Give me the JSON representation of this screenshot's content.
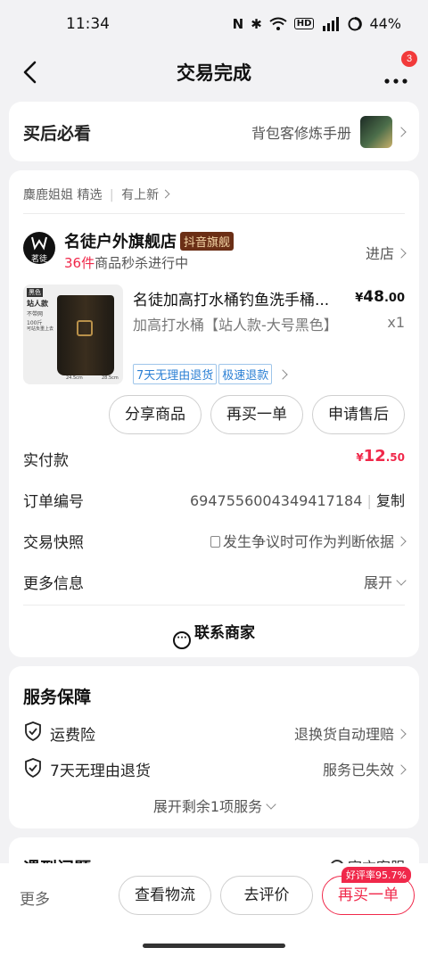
{
  "status_bar": {
    "time": "11:34",
    "battery": "44%"
  },
  "header": {
    "title": "交易完成",
    "badge_count": "3"
  },
  "aftersale": {
    "label": "买后必看",
    "guide": "背包客修炼手册"
  },
  "order": {
    "source": "麋鹿姐姐 精选",
    "source_link": "有上新",
    "store": {
      "name": "名徒户外旗舰店",
      "tag": "抖音旗舰",
      "flash_count": "36件",
      "flash_text": "商品秒杀进行中",
      "enter_label": "进店",
      "logo_text": "茗徒"
    },
    "product": {
      "title": "名徒加高打水桶钓鱼洗手桶...",
      "variant": "加高打水桶【站人款-大号黑色】",
      "price_symbol": "¥",
      "price_int": "48",
      "price_dec": ".00",
      "qty": "x1",
      "tags": [
        "7天无理由退货",
        "极速退款"
      ],
      "thumb_texts": [
        "黑色",
        "站人款",
        "不带网",
        "100斤",
        "可站负重上去",
        "24.5cm",
        "28.5cm"
      ]
    },
    "actions": [
      "分享商品",
      "再买一单",
      "申请售后"
    ],
    "paid": {
      "label": "实付款",
      "symbol": "¥",
      "int": "12",
      "dec": ".50"
    },
    "order_no": {
      "label": "订单编号",
      "value": "6947556004349417184",
      "copy": "复制"
    },
    "snapshot": {
      "label": "交易快照",
      "value": "发生争议时可作为判断依据"
    },
    "more_info": {
      "label": "更多信息",
      "value": "展开"
    },
    "contact": "联系商家"
  },
  "service": {
    "title": "服务保障",
    "items": [
      {
        "name": "运费险",
        "value": "退换货自动理赔"
      },
      {
        "name": "7天无理由退货",
        "value": "服务已失效"
      }
    ],
    "expand": "展开剩余1项服务"
  },
  "next_card": {
    "title": "遇到问题",
    "right": "官方客服"
  },
  "bottom": {
    "more": "更多",
    "logistics": "查看物流",
    "review": "去评价",
    "rebuy": "再买一单",
    "rating": "好评率95.7%"
  },
  "colors": {
    "accent_red": "#f0284a",
    "brand_brown": "#7a3b1c",
    "tag_blue": "#2a7fd4"
  }
}
